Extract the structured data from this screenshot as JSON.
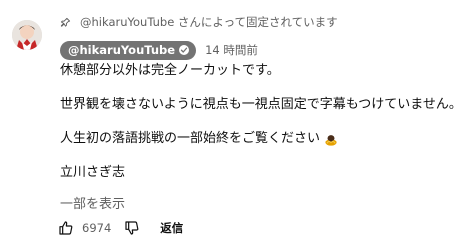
{
  "pinned_text": "@hikaruYouTube さんによって固定されています",
  "author": "@hikaruYouTube",
  "time": "14 時間前",
  "lines": [
    "休憩部分以外は完全ノーカットです。",
    "世界観を壊さないように視点も一視点固定で字幕もつけていません。",
    "人生初の落語挑戦の一部始終をご覧ください",
    "立川さぎ志"
  ],
  "show_more": "一部を表示",
  "like_count": "6974",
  "reply_label": "返信",
  "icons": [
    "pin-icon",
    "verified-check-icon",
    "bowing-person-emoji",
    "thumbs-up-icon",
    "thumbs-down-icon"
  ]
}
